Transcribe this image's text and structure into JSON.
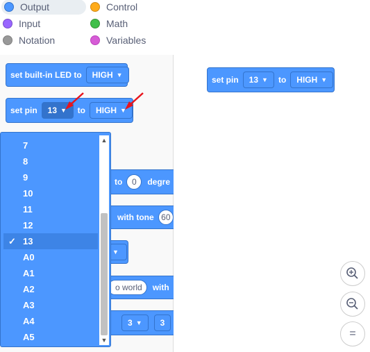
{
  "categories": [
    {
      "label": "Output",
      "color": "#4c97ff",
      "selected": true
    },
    {
      "label": "Control",
      "color": "#ffab19"
    },
    {
      "label": "Input",
      "color": "#9966ff"
    },
    {
      "label": "Math",
      "color": "#40bf4a"
    },
    {
      "label": "Notation",
      "color": "#999999"
    },
    {
      "label": "Variables",
      "color": "#d65cd6"
    }
  ],
  "palette": {
    "builtin_led": {
      "label": "set built-in LED to",
      "value": "HIGH"
    },
    "set_pin": {
      "label": "set pin",
      "pin": "13",
      "to": "to",
      "value": "HIGH"
    },
    "servo": {
      "to": "to",
      "value": "0",
      "unit": "degre"
    },
    "tone": {
      "label": "with tone",
      "value": "60"
    },
    "serial": {
      "text": "o world",
      "with": "with"
    },
    "extra": {
      "value1": "3",
      "value2": "3"
    }
  },
  "workspace": {
    "set_pin": {
      "label": "set pin",
      "pin": "13",
      "to": "to",
      "value": "HIGH"
    }
  },
  "dropdown": {
    "options": [
      "7",
      "8",
      "9",
      "10",
      "11",
      "12",
      "13",
      "A0",
      "A1",
      "A2",
      "A3",
      "A4",
      "A5"
    ],
    "selected": "13",
    "checkmark": "✓"
  },
  "zoom": {
    "in": "zoom-in",
    "out": "zoom-out",
    "reset": "="
  },
  "colors": {
    "block": "#4c97ff",
    "block_border": "#3373cc",
    "annotation": "#e8141c"
  }
}
